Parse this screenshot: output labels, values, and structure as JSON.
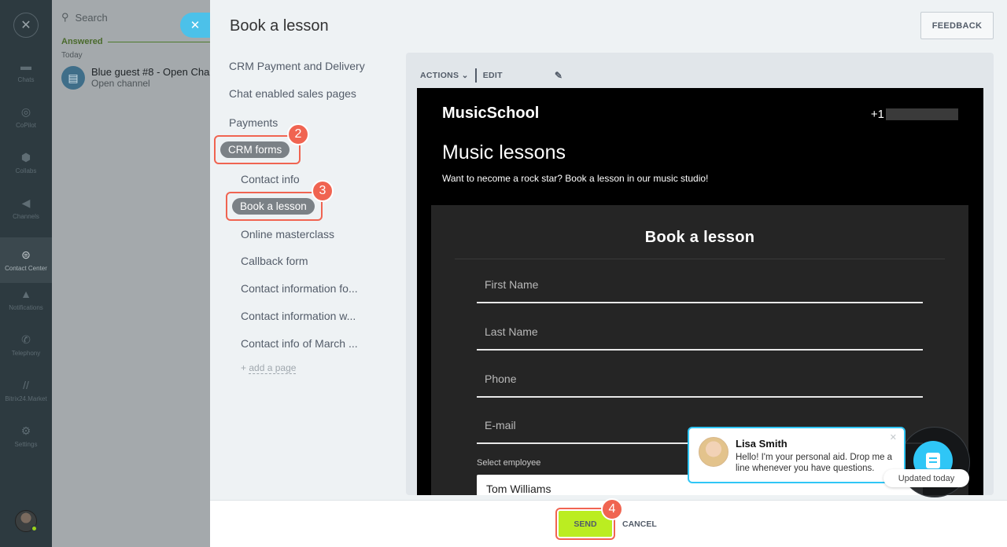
{
  "nav": {
    "items": [
      {
        "label": "Chats",
        "icon": "chats-icon",
        "glyph": "▬"
      },
      {
        "label": "CoPilot",
        "icon": "copilot-icon",
        "glyph": "◎"
      },
      {
        "label": "Collabs",
        "icon": "collabs-icon",
        "glyph": "⬢"
      },
      {
        "label": "Channels",
        "icon": "channels-icon",
        "glyph": "◀"
      },
      {
        "label": "Contact Center",
        "icon": "contact-center-icon",
        "glyph": "⊜"
      },
      {
        "label": "Notifications",
        "icon": "bell-icon",
        "glyph": "▲"
      },
      {
        "label": "Telephony",
        "icon": "phone-icon",
        "glyph": "✆"
      },
      {
        "label": "Bitrix24.Market",
        "icon": "market-icon",
        "glyph": "//"
      },
      {
        "label": "Settings",
        "icon": "gear-icon",
        "glyph": "⚙"
      }
    ],
    "active_index": 4
  },
  "chatlist": {
    "search_placeholder": "Search",
    "section": "Answered",
    "group": "Today",
    "chat": {
      "name": "Blue guest #8 - Open Cha",
      "subtitle": "Open channel"
    }
  },
  "slider": {
    "title": "Book a lesson",
    "feedback": "FEEDBACK",
    "menu": {
      "top": [
        "CRM Payment and Delivery",
        "Chat enabled sales pages",
        "Payments"
      ],
      "crm_forms": "CRM forms",
      "contact_info": "Contact info",
      "book_lesson": "Book a lesson",
      "rest": [
        "Online masterclass",
        "Callback form",
        "Contact information fo...",
        "Contact information w...",
        "Contact info of March ..."
      ],
      "add_page_plus": "+",
      "add_page": "add a page"
    },
    "badges": [
      "2",
      "3",
      "4"
    ]
  },
  "preview": {
    "actions": "ACTIONS",
    "edit": "EDIT",
    "site": {
      "logo": "MusicSchool",
      "phone_prefix": "+1",
      "headline": "Music lessons",
      "tagline": "Want to necome a rock star? Book a lesson in our music studio!"
    },
    "form": {
      "title": "Book a lesson",
      "fields": [
        "First Name",
        "Last Name",
        "Phone",
        "E-mail"
      ],
      "select_label": "Select employee",
      "select_value": "Tom Williams"
    }
  },
  "widget": {
    "agent": "Lisa Smith",
    "message": "Hello! I'm your personal aid. Drop me a line whenever you have questions.",
    "updated": "Updated today"
  },
  "footer": {
    "send": "SEND",
    "cancel": "CANCEL"
  },
  "colors": {
    "accent_send": "#bbed21",
    "highlight": "#f06451",
    "widget": "#2fc6f6"
  }
}
